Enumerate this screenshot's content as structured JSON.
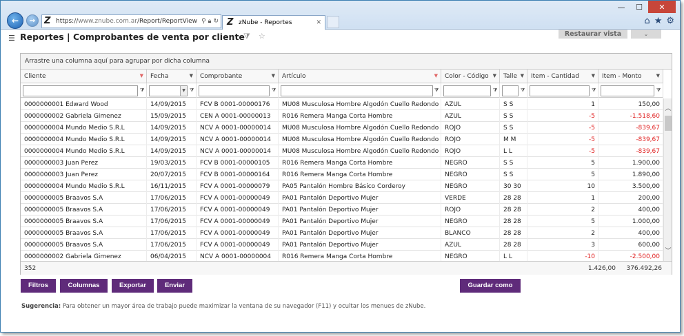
{
  "browser": {
    "url_prefix": "https://",
    "url_domain": "www.znube.com.ar",
    "url_path": "/Report/ReportView",
    "tab_title": "zNube - Reportes",
    "window_controls": {
      "minimize": "—",
      "maximize": "☐",
      "close": "✕"
    }
  },
  "page": {
    "title": "Reportes | Comprobantes de venta por cliente",
    "restore_button": "Restaurar vista"
  },
  "grid": {
    "group_hint": "Arrastre una columna aquí para agrupar por dicha columna",
    "columns": [
      "Cliente",
      "Fecha",
      "Comprobante",
      "Artículo",
      "Color - Código",
      "Talle",
      "Item - Cantidad",
      "Item - Monto"
    ],
    "rows": [
      [
        "0000000001 Edward Wood",
        "14/09/2015",
        "FCV B 0001-00000176",
        "MU08 Musculosa Hombre Algodón Cuello Redondo",
        "AZUL",
        "S S",
        "1",
        "150,00"
      ],
      [
        "0000000002 Gabriela Gimenez",
        "15/09/2015",
        "CEN A 0001-00000013",
        "R016 Remera Manga Corta Hombre",
        "AZUL",
        "S S",
        "-5",
        "-1.518,60"
      ],
      [
        "0000000004 Mundo Medio S.R.L",
        "14/09/2015",
        "NCV A 0001-00000014",
        "MU08 Musculosa Hombre Algodón Cuello Redondo",
        "ROJO",
        "S S",
        "-5",
        "-839,67"
      ],
      [
        "0000000004 Mundo Medio S.R.L",
        "14/09/2015",
        "NCV A 0001-00000014",
        "MU08 Musculosa Hombre Algodón Cuello Redondo",
        "ROJO",
        "M M",
        "-5",
        "-839,67"
      ],
      [
        "0000000004 Mundo Medio S.R.L",
        "14/09/2015",
        "NCV A 0001-00000014",
        "MU08 Musculosa Hombre Algodón Cuello Redondo",
        "ROJO",
        "L L",
        "-5",
        "-839,67"
      ],
      [
        "0000000003 Juan Perez",
        "19/03/2015",
        "FCV B 0001-00000105",
        "R016 Remera Manga Corta Hombre",
        "NEGRO",
        "S S",
        "5",
        "1.900,00"
      ],
      [
        "0000000003 Juan Perez",
        "20/07/2015",
        "FCV B 0001-00000164",
        "R016 Remera Manga Corta Hombre",
        "NEGRO",
        "S S",
        "5",
        "1.890,00"
      ],
      [
        "0000000004 Mundo Medio S.R.L",
        "16/11/2015",
        "FCV A 0001-00000079",
        "PA05 Pantalón Hombre Básico Corderoy",
        "NEGRO",
        "30 30",
        "10",
        "3.500,00"
      ],
      [
        "0000000005 Braavos S.A",
        "17/06/2015",
        "FCV A 0001-00000049",
        "PA01 Pantalón Deportivo Mujer",
        "VERDE",
        "28 28",
        "1",
        "200,00"
      ],
      [
        "0000000005 Braavos S.A",
        "17/06/2015",
        "FCV A 0001-00000049",
        "PA01 Pantalón Deportivo Mujer",
        "ROJO",
        "28 28",
        "2",
        "400,00"
      ],
      [
        "0000000005 Braavos S.A",
        "17/06/2015",
        "FCV A 0001-00000049",
        "PA01 Pantalón Deportivo Mujer",
        "NEGRO",
        "28 28",
        "5",
        "1.000,00"
      ],
      [
        "0000000005 Braavos S.A",
        "17/06/2015",
        "FCV A 0001-00000049",
        "PA01 Pantalón Deportivo Mujer",
        "BLANCO",
        "28 28",
        "2",
        "400,00"
      ],
      [
        "0000000005 Braavos S.A",
        "17/06/2015",
        "FCV A 0001-00000049",
        "PA01 Pantalón Deportivo Mujer",
        "AZUL",
        "28 28",
        "3",
        "600,00"
      ],
      [
        "0000000002 Gabriela Gimenez",
        "06/04/2015",
        "NCV A 0001-00000004",
        "R016 Remera Manga Corta Hombre",
        "NEGRO",
        "L L",
        "-10",
        "-2.500,00"
      ]
    ],
    "footer": {
      "count": "352",
      "sum_quantity": "1.426,00",
      "sum_amount": "376.492,26"
    }
  },
  "buttons": {
    "filtros": "Filtros",
    "columnas": "Columnas",
    "exportar": "Exportar",
    "enviar": "Enviar",
    "guardar": "Guardar como"
  },
  "hint": {
    "label": "Sugerencia:",
    "text": "Para obtener un mayor área de trabajo puede maximizar la ventana de su navegador (F11) y ocultar los menues de zNube."
  },
  "colors": {
    "accent_purple": "#5f2b7a",
    "negative_red": "#e02020"
  }
}
